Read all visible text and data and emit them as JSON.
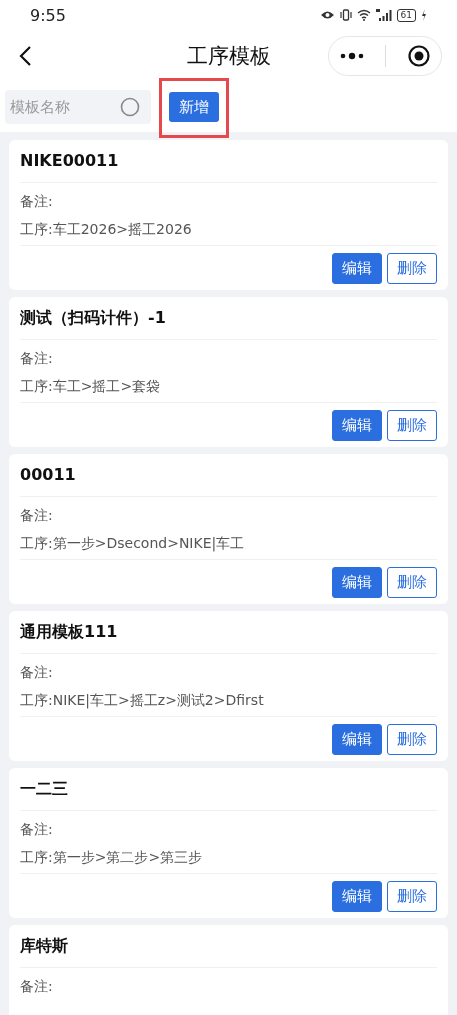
{
  "status_bar": {
    "time": "9:55",
    "battery": "61"
  },
  "header": {
    "title": "工序模板"
  },
  "search": {
    "placeholder": "模板名称",
    "highlighted_button": true,
    "add_button": "新增"
  },
  "templates": [
    {
      "name": "NIKE00011",
      "remark": "备注:",
      "process": "工序:车工2026>摇工2026",
      "actions": [
        "编辑",
        "删除"
      ]
    },
    {
      "name": "测试（扫码计件）-1",
      "remark": "备注:",
      "process": "工序:车工>摇工>套袋",
      "actions": [
        "编辑",
        "删除"
      ]
    },
    {
      "name": "00011",
      "remark": "备注:",
      "process": "工序:第一步>Dsecond>NIKE|车工",
      "actions": [
        "编辑",
        "删除"
      ]
    },
    {
      "name": "通用模板111",
      "remark": "备注:",
      "process": "工序:NIKE|车工>摇工z>测试2>Dfirst",
      "actions": [
        "编辑",
        "删除"
      ]
    },
    {
      "name": "一二三",
      "remark": "备注:",
      "process": "工序:第一步>第二步>第三步",
      "actions": [
        "编辑",
        "删除"
      ]
    },
    {
      "name": "库特斯",
      "remark": "备注:"
    }
  ]
}
